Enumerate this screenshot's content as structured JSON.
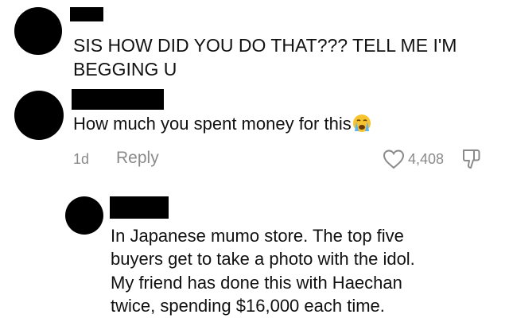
{
  "comments": [
    {
      "text_lines": [
        "SIS HOW DID YOU DO THAT??? TELL ME I'M",
        "BEGGING U"
      ]
    },
    {
      "text": "How much you spent money for this",
      "emoji": "loudly-crying-face-emoji",
      "age": "1d",
      "reply_label": "Reply",
      "likes": "4,408"
    }
  ],
  "reply": {
    "text_lines": [
      "In Japanese mumo store. The top five",
      "buyers get to take a photo with the idol.",
      "My friend has done this with Haechan",
      "twice, spending $16,000 each time."
    ]
  },
  "colors": {
    "text": "#111111",
    "muted": "#8a8a8a",
    "redaction": "#000000"
  }
}
